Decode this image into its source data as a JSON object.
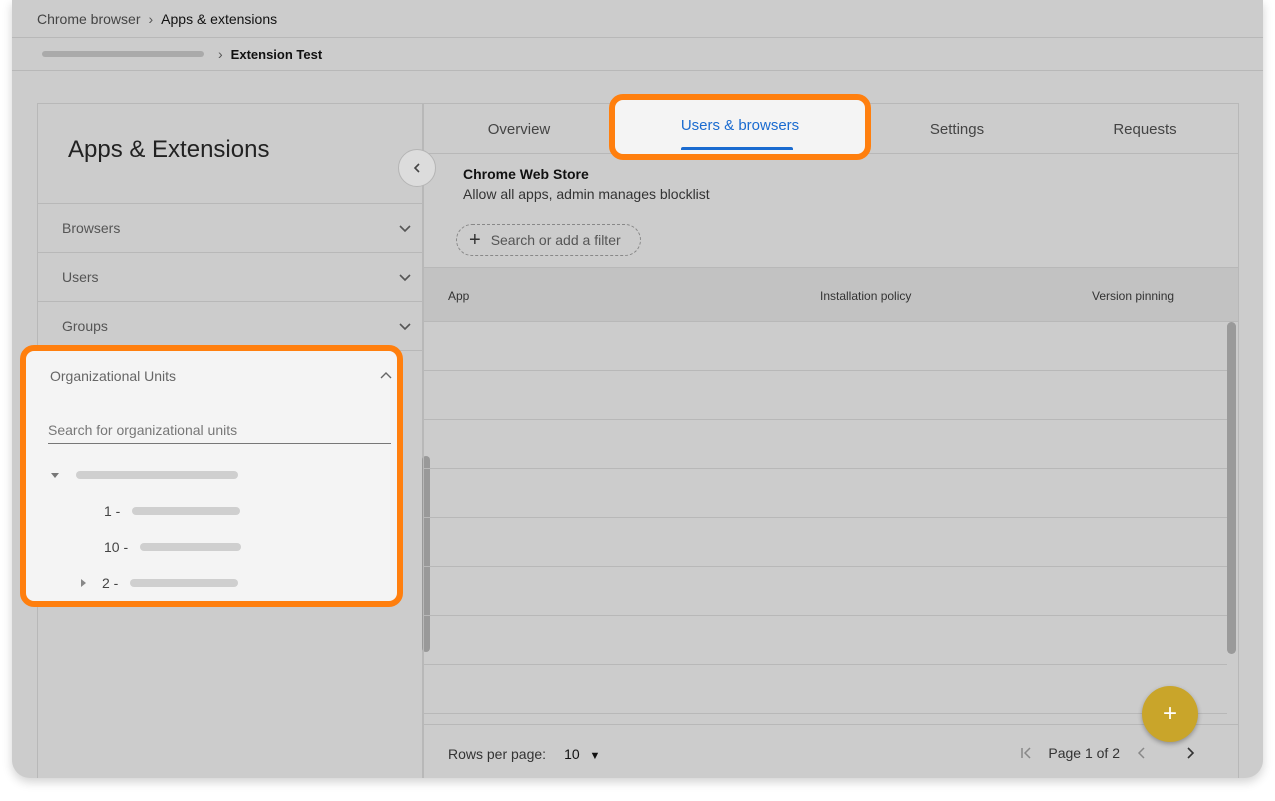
{
  "breadcrumb": {
    "root": "Chrome browser",
    "current": "Apps & extensions"
  },
  "subcrumb": {
    "current": "Extension Test"
  },
  "left_panel": {
    "title": "Apps & Extensions",
    "sections": [
      {
        "label": "Browsers"
      },
      {
        "label": "Users"
      },
      {
        "label": "Groups"
      }
    ],
    "org_units": {
      "label": "Organizational Units",
      "search_placeholder": "Search for organizational units",
      "tree": [
        {
          "prefix": ""
        },
        {
          "prefix": "1 -"
        },
        {
          "prefix": "10 -"
        },
        {
          "prefix": "2 -"
        }
      ]
    }
  },
  "tabs": [
    {
      "label": "Overview"
    },
    {
      "label": "Users & browsers"
    },
    {
      "label": "Settings"
    },
    {
      "label": "Requests"
    }
  ],
  "store": {
    "title": "Chrome Web Store",
    "subtitle": "Allow all apps, admin manages blocklist"
  },
  "filter": {
    "label": "Search or add a filter"
  },
  "table": {
    "columns": [
      "App",
      "Installation policy",
      "Version pinning"
    ]
  },
  "footer": {
    "rows_per_page_label": "Rows per page:",
    "rows_per_page_value": "10",
    "page_label": "Page 1 of 2"
  },
  "fab": {
    "symbol": "+"
  },
  "colors": {
    "highlight": "#ff7f0e",
    "accent": "#1a6bd0",
    "fab": "#c9a52a"
  }
}
